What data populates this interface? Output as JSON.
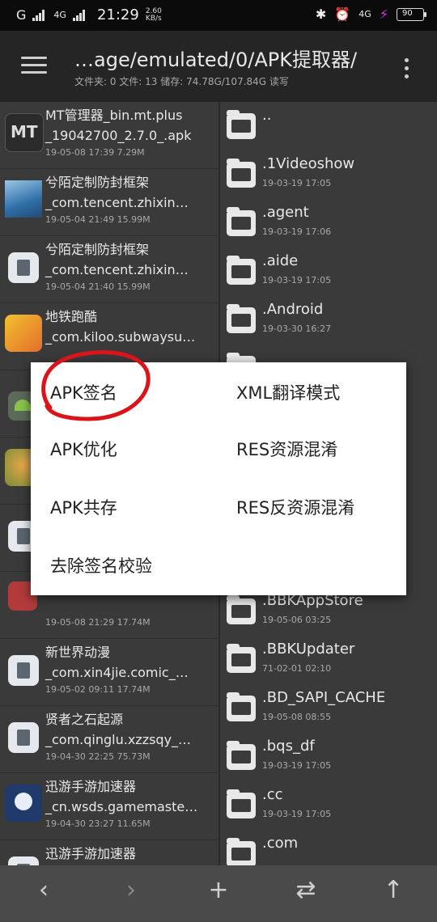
{
  "status": {
    "carrier1": "G",
    "carrier2": "4G",
    "time": "21:29",
    "speed_value": "2.60",
    "speed_unit": "KB/s",
    "net": "4G",
    "battery": "90"
  },
  "header": {
    "path": "…age/emulated/0/APK提取器/",
    "stats": "文件夹: 0  文件: 13  储存: 74.78G/107.84G  读写"
  },
  "left_files": [
    {
      "name1": "MT管理器_bin.mt.plus",
      "name2": "_19042700_2.7.0_.apk",
      "meta": "19-05-08 17:39  7.29M",
      "thumb": "mt-logo"
    },
    {
      "name1": "兮陌定制防封框架",
      "name2": "_com.tencent.zhixin…",
      "meta": "19-05-04 21:49  15.99M",
      "thumb": "photo"
    },
    {
      "name1": "兮陌定制防封框架",
      "name2": "_com.tencent.zhixin…",
      "meta": "19-05-04 21:40  15.99M",
      "thumb": "file"
    },
    {
      "name1": "地铁跑酷",
      "name2": "_com.kiloo.subwaysu…",
      "meta": "",
      "thumb": "game"
    },
    {
      "name1": "",
      "name2": "",
      "meta": "",
      "thumb": "android"
    },
    {
      "name1": "",
      "name2": "",
      "meta": "",
      "thumb": "cat"
    },
    {
      "name1": "",
      "name2": "",
      "meta": "",
      "thumb": "file"
    },
    {
      "name1": "",
      "name2": "",
      "meta": "19-05-08 21:29  17.74M",
      "thumb": "robot"
    },
    {
      "name1": "新世界动漫",
      "name2": "_com.xin4jie.comic_…",
      "meta": "19-05-02 09:11  17.74M",
      "thumb": "file"
    },
    {
      "name1": "贤者之石起源",
      "name2": "_com.qinglu.xzzsqy_…",
      "meta": "19-04-30 22:25  75.73M",
      "thumb": "file"
    },
    {
      "name1": "迅游手游加速器",
      "name2": "_cn.wsds.gamemaste…",
      "meta": "19-04-30 23:27  11.65M",
      "thumb": "xunyou"
    },
    {
      "name1": "迅游手游加速器",
      "name2": "",
      "meta": "",
      "thumb": "file"
    }
  ],
  "right_dirs": [
    {
      "name": "..",
      "meta": ""
    },
    {
      "name": ".1Videoshow",
      "meta": "19-03-19 17:05"
    },
    {
      "name": ".agent",
      "meta": "19-03-19 17:06"
    },
    {
      "name": ".aide",
      "meta": "19-03-19 17:05"
    },
    {
      "name": ".Android",
      "meta": "19-03-30 16:27"
    },
    {
      "name": "",
      "meta": ""
    },
    {
      "name": "",
      "meta": ""
    },
    {
      "name": "",
      "meta": ""
    },
    {
      "name": "",
      "meta": ""
    },
    {
      "name": "",
      "meta": ""
    },
    {
      "name": ".BBKAppStore",
      "meta": "19-05-06 03:25"
    },
    {
      "name": ".BBKUpdater",
      "meta": "71-02-01 02:10"
    },
    {
      "name": ".BD_SAPI_CACHE",
      "meta": "19-05-08 08:55"
    },
    {
      "name": ".bqs_df",
      "meta": "19-03-19 17:05"
    },
    {
      "name": ".cc",
      "meta": "19-03-19 17:05"
    },
    {
      "name": ".com",
      "meta": ""
    }
  ],
  "dialog": {
    "apk_sign": "APK签名",
    "xml_translate": "XML翻译模式",
    "apk_optimize": "APK优化",
    "res_obfuscate": "RES资源混淆",
    "apk_coexist": "APK共存",
    "res_deobfuscate": "RES反资源混淆",
    "remove_sign_check": "去除签名校验",
    "highlight_color": "#d9141a"
  },
  "bottom": {
    "back": "‹",
    "forward": "›",
    "add": "+",
    "swap": "⇄",
    "up": "↑"
  }
}
